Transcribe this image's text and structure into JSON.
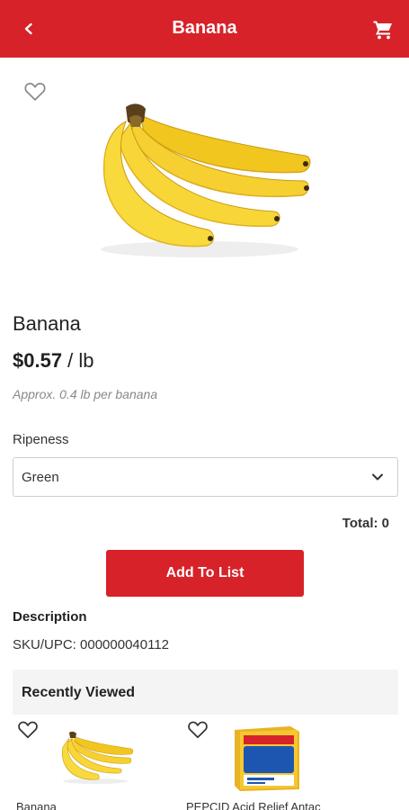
{
  "header": {
    "title": "Banana",
    "back_icon": "chevron-left-icon",
    "cart_icon": "cart-icon",
    "bg_color": "#d72229"
  },
  "product": {
    "name": "Banana",
    "price_amount": "$0.57",
    "price_unit": " / lb",
    "approx": "Approx. 0.4 lb per banana",
    "ripeness_label": "Ripeness",
    "ripeness_selected": "Green",
    "total": "Total: 0",
    "add_button": "Add To List"
  },
  "description": {
    "heading": "Description",
    "sku": "SKU/UPC: 000000040112"
  },
  "recently_viewed": {
    "heading": "Recently Viewed",
    "items": [
      {
        "name": "Banana"
      },
      {
        "name": "PEPCID Acid Relief Antac"
      }
    ]
  }
}
